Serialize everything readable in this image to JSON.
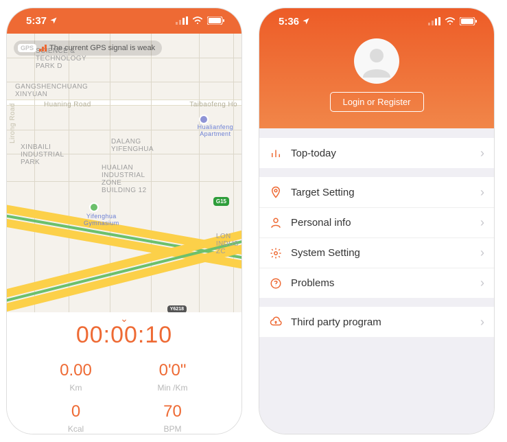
{
  "phone1": {
    "status": {
      "time": "5:37"
    },
    "gps": {
      "tag": "GPS",
      "message": "The current GPS signal is weak"
    },
    "map_labels": {
      "park": "SCIENCE &\nTECHNOLOGY\nPARK D",
      "gangshen": "GANGSHENCHUANG\nXINYUAN",
      "huaning": "Huaning Road",
      "taibaofeng": "Taibaofeng Ho",
      "hualianfeng": "Hualianfeng\nApartment",
      "xinbai": "XINBAILI\nINDUSTRIAL\nPARK",
      "dalang": "DALANG\nYIFENGHUA",
      "hualian": "HUALIAN\nINDUSTRIAL\nZONE\nBUILDING 12",
      "yifenghua": "Yifenghua\nGymnasium",
      "long": "LON\nINDUS\nZC",
      "g15": "G15",
      "y6218": "Y6218",
      "lirong": "Lirong Road"
    },
    "timer": "00:00:10",
    "metrics": {
      "km": {
        "value": "0.00",
        "unit": "Km"
      },
      "pace": {
        "value": "0'0\"",
        "unit": "Min /Km"
      },
      "kcal": {
        "value": "0",
        "unit": "Kcal"
      },
      "bpm": {
        "value": "70",
        "unit": "BPM"
      }
    }
  },
  "phone2": {
    "status": {
      "time": "5:36"
    },
    "login_label": "Login or Register",
    "menu": {
      "top_today": "Top-today",
      "target": "Target Setting",
      "personal": "Personal info",
      "system": "System Setting",
      "problems": "Problems",
      "third_party": "Third party program"
    }
  }
}
